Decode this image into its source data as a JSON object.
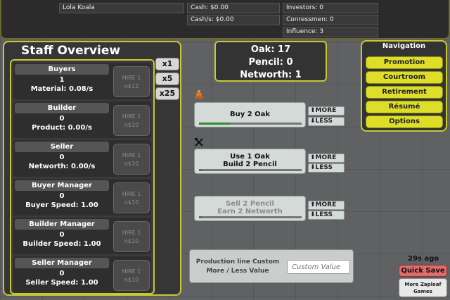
{
  "topbar": {
    "player_name": "Lola Koala",
    "cash": "Cash: $0.00",
    "cash_per_sec": "Cash/s: $0.00",
    "investors": "Investors: 0",
    "congressmen": "Conressmen: 0",
    "influence": "Influence: 3"
  },
  "staff": {
    "title": "Staff Overview",
    "rows": [
      {
        "name": "Buyers",
        "count": "1",
        "rate": "Material: 0.08/s",
        "hire_label": "HIRE 1",
        "hire_cost": "n$12"
      },
      {
        "name": "Builder",
        "count": "0",
        "rate": "Product: 0.00/s",
        "hire_label": "HIRE 1",
        "hire_cost": "n$10"
      },
      {
        "name": "Seller",
        "count": "0",
        "rate": "Networth: 0.00/s",
        "hire_label": "HIRE 1",
        "hire_cost": "n$10"
      },
      {
        "name": "Buyer Manager",
        "count": "0",
        "rate": "Buyer Speed: 1.00",
        "hire_label": "HIRE 1",
        "hire_cost": "n$10"
      },
      {
        "name": "Builder Manager",
        "count": "0",
        "rate": "Builder Speed: 1.00",
        "hire_label": "HIRE 1",
        "hire_cost": "n$10"
      },
      {
        "name": "Seller Manager",
        "count": "0",
        "rate": "Seller Speed: 1.00",
        "hire_label": "HIRE 1",
        "hire_cost": "n$10"
      }
    ]
  },
  "multipliers": [
    "x1",
    "x5",
    "x25"
  ],
  "resources": {
    "oak": "Oak: 17",
    "pencil": "Pencil: 0",
    "networth": "Networth: 1"
  },
  "navigation": {
    "title": "Navigation",
    "items": [
      "Promotion",
      "Courtroom",
      "Retirement",
      "Résumé",
      "Options"
    ]
  },
  "production": [
    {
      "line1": "Buy 2 Oak",
      "line2": "",
      "progress": 0.3,
      "more": "MORE",
      "less": "LESS",
      "dim": false
    },
    {
      "line1": "Use 1 Oak",
      "line2": "Build 2 Pencil",
      "progress": 0.03,
      "more": "MORE",
      "less": "LESS",
      "dim": false
    },
    {
      "line1": "Sell 2 Pencil",
      "line2": "Earn 2 Networth",
      "progress": 0.03,
      "more": "MORE",
      "less": "LESS",
      "dim": true
    }
  ],
  "custom": {
    "label": "Production line Custom More / Less Value",
    "placeholder": "Custom Value"
  },
  "save": {
    "ago": "29s ago",
    "quicksave": "Quick Save",
    "more_games": "More Zapleaf Games"
  },
  "colors": {
    "accent_yellow": "#c8c835",
    "nav_button": "#dede2a",
    "quicksave": "#e06d6d",
    "progress_green": "#2c8f2c"
  }
}
